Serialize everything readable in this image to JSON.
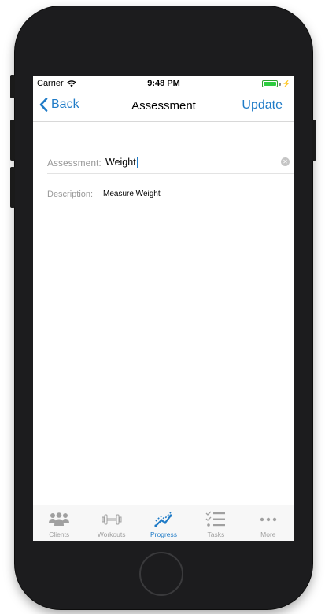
{
  "status_bar": {
    "carrier": "Carrier",
    "time": "9:48 PM"
  },
  "nav": {
    "back_label": "Back",
    "title": "Assessment",
    "action_label": "Update"
  },
  "form": {
    "assessment_label": "Assessment:",
    "assessment_value": "Weight",
    "description_label": "Description:",
    "description_value": "Measure Weight"
  },
  "tabs": [
    {
      "label": "Clients",
      "icon": "people-icon",
      "active": false
    },
    {
      "label": "Workouts",
      "icon": "dumbbell-icon",
      "active": false
    },
    {
      "label": "Progress",
      "icon": "trend-icon",
      "active": true
    },
    {
      "label": "Tasks",
      "icon": "checklist-icon",
      "active": false
    },
    {
      "label": "More",
      "icon": "more-icon",
      "active": false
    }
  ],
  "colors": {
    "accent": "#1f7bc7",
    "inactive": "#a0a0a0",
    "battery": "#2ecc40"
  }
}
